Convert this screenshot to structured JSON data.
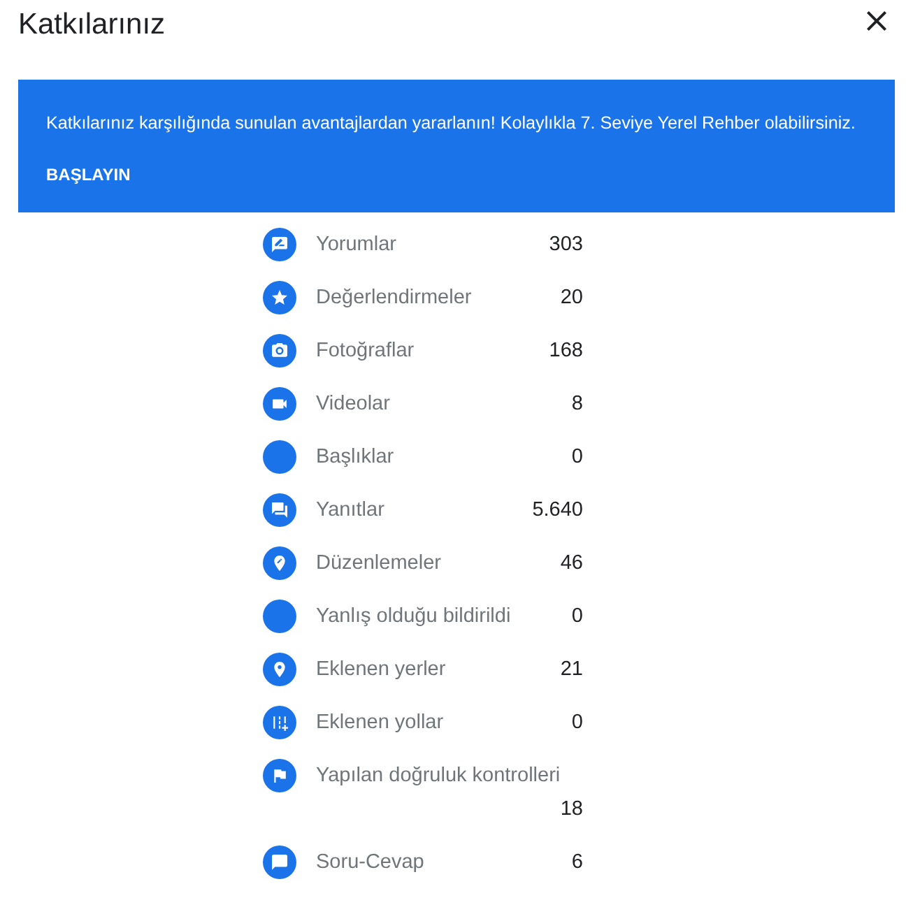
{
  "dialog": {
    "title": "Katkılarınız"
  },
  "banner": {
    "text": "Katkılarınız karşılığında sunulan avantajlardan yararlanın! Kolaylıkla 7. Seviye Yerel Rehber olabilirsiniz.",
    "action": "BAŞLAYIN"
  },
  "stats": [
    {
      "kind": "review",
      "label": "Yorumlar",
      "value": "303"
    },
    {
      "kind": "rating",
      "label": "Değerlendirmeler",
      "value": "20"
    },
    {
      "kind": "photo",
      "label": "Fotoğraflar",
      "value": "168"
    },
    {
      "kind": "video",
      "label": "Videolar",
      "value": "8"
    },
    {
      "kind": "title",
      "label": "Başlıklar",
      "value": "0"
    },
    {
      "kind": "answer",
      "label": "Yanıtlar",
      "value": "5.640"
    },
    {
      "kind": "edit",
      "label": "Düzenlemeler",
      "value": "46"
    },
    {
      "kind": "report",
      "label": "Yanlış olduğu bildirildi",
      "value": "0"
    },
    {
      "kind": "place",
      "label": "Eklenen yerler",
      "value": "21"
    },
    {
      "kind": "road",
      "label": "Eklenen yollar",
      "value": "0"
    },
    {
      "kind": "check",
      "label": "Yapılan doğruluk kontrolleri",
      "value": "18"
    },
    {
      "kind": "qa",
      "label": "Soru-Cevap",
      "value": "6"
    }
  ]
}
